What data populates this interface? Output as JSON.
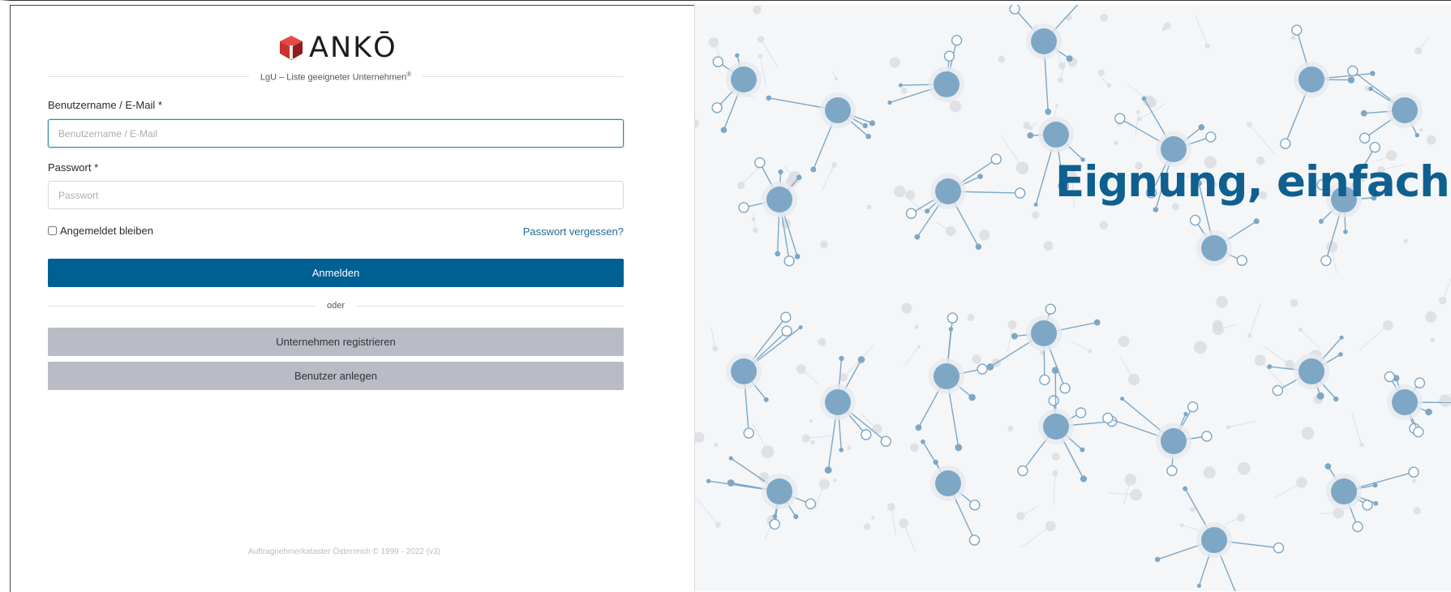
{
  "brand": {
    "logo_text": "ANKŌ",
    "subtitle": "LgU – Liste geeigneter Unternehmen",
    "subtitle_mark": "®"
  },
  "login_form": {
    "username_label": "Benutzername / E-Mail *",
    "username_placeholder": "Benutzername / E-Mail",
    "username_value": "",
    "password_label": "Passwort *",
    "password_placeholder": "Passwort",
    "password_value": "",
    "remember_label": "Angemeldet bleiben",
    "remember_checked": false,
    "forgot_link": "Passwort vergessen?",
    "login_button": "Anmelden",
    "or_separator": "oder",
    "register_button": "Unternehmen registrieren",
    "create_user_button": "Benutzer anlegen"
  },
  "footer": {
    "copyright": "Auftragnehmerkataster Österreich © 1999 - 2022 (v3)"
  },
  "hero": {
    "tagline": "Eignung, einfach!"
  },
  "colors": {
    "primary": "#005f93",
    "secondary_button": "#b9bcc4",
    "link": "#1f6a99",
    "tagline": "#0f5f8f",
    "network_node": "#7ea7c6",
    "hero_background": "#f4f6f8",
    "logo_red": "#c8322f"
  },
  "icons": {
    "logo_mark": "cube-logo-icon",
    "hero_art": "network-graph-icon"
  }
}
